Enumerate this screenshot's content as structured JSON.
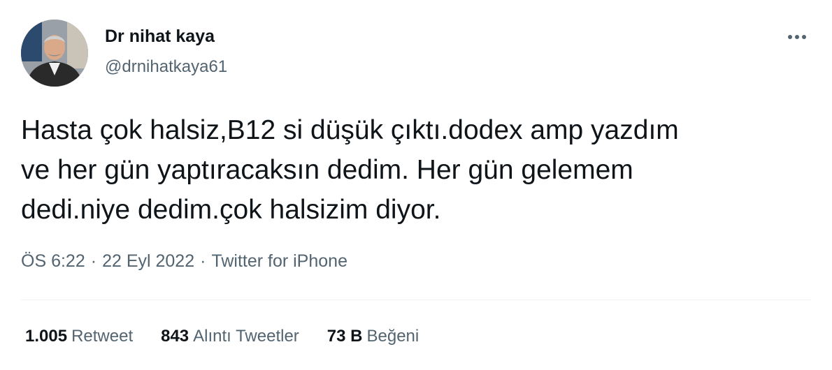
{
  "author": {
    "display_name": "Dr nihat kaya",
    "handle": "@drnihatkaya61"
  },
  "tweet": {
    "text": "Hasta çok halsiz,B12 si düşük çıktı.dodex amp yazdım\nve her gün yaptıracaksın dedim. Her gün gelemem\ndedi.niye dedim.çok halsizim diyor."
  },
  "meta": {
    "time": "ÖS 6:22",
    "separator": "·",
    "date": "22 Eyl 2022",
    "source": "Twitter for iPhone"
  },
  "stats": {
    "retweets": {
      "count": "1.005",
      "label": "Retweet"
    },
    "quotes": {
      "count": "843",
      "label": "Alıntı Tweetler"
    },
    "likes": {
      "count": "73 B",
      "label": "Beğeni"
    }
  },
  "icons": {
    "more": "more-horizontal-icon"
  },
  "colors": {
    "text_primary": "#0f1419",
    "text_secondary": "#536471",
    "divider": "#eff3f4"
  }
}
